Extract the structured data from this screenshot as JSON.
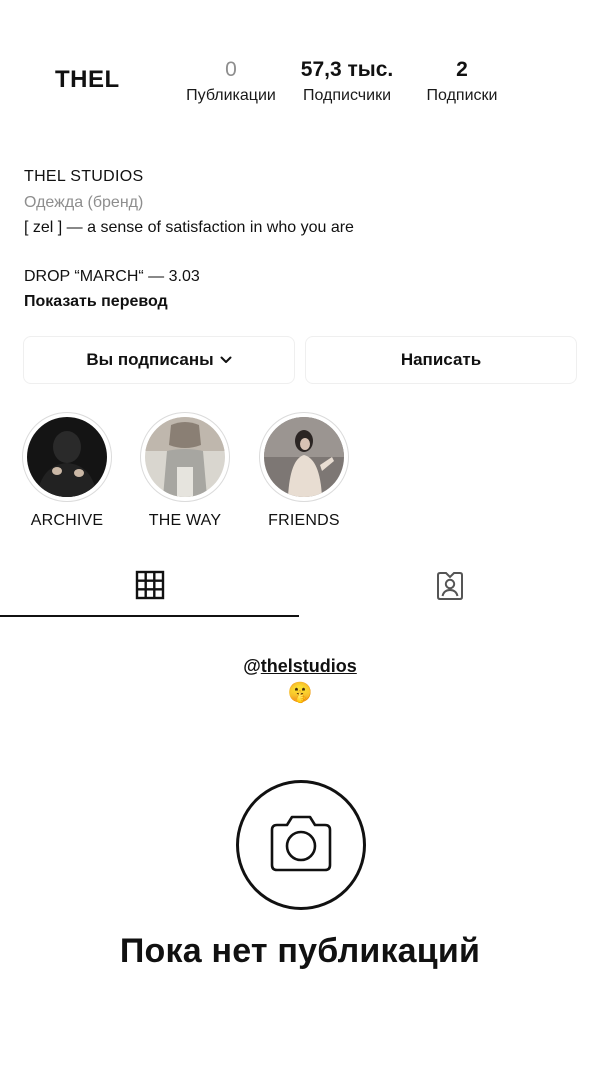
{
  "profile": {
    "username": "THEL",
    "stats": [
      {
        "value": "0",
        "label": "Публикации"
      },
      {
        "value": "57,3 тыс.",
        "label": "Подписчики"
      },
      {
        "value": "2",
        "label": "Подписки"
      }
    ]
  },
  "bio": {
    "name": "THEL STUDIOS",
    "category": "Одежда (бренд)",
    "line1": "[ zel ] — a sense of satisfaction in who you are",
    "line2": "DROP “MARCH“ — 3.03",
    "translate": "Показать перевод"
  },
  "buttons": {
    "following": "Вы подписаны",
    "message": "Написать"
  },
  "highlights": [
    {
      "label": "ARCHIVE"
    },
    {
      "label": "THE WAY"
    },
    {
      "label": "FRIENDS"
    }
  ],
  "tabs": {
    "grid_icon": "grid-icon",
    "tagged_icon": "tagged-person-icon",
    "active": "grid"
  },
  "feed": {
    "mention_prefix": "@",
    "mention_handle": "thelstudios",
    "emoji": "🤫",
    "empty_icon": "camera-icon",
    "empty_text": "Пока нет публикаций"
  }
}
